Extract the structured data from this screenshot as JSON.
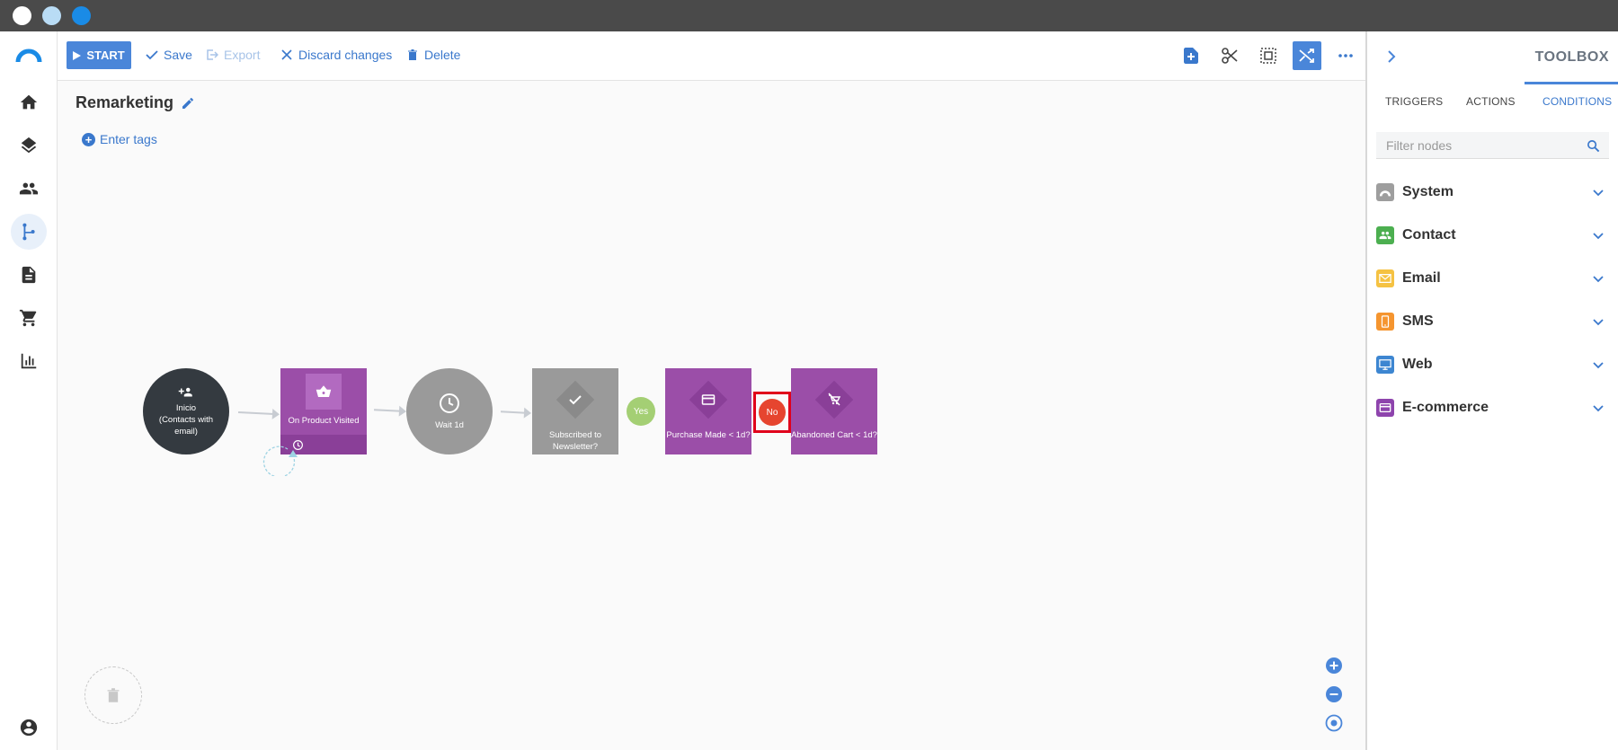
{
  "window": {
    "controls": [
      "close",
      "minimize",
      "maximize"
    ]
  },
  "nav": {
    "items": [
      {
        "name": "home",
        "icon": "home-icon"
      },
      {
        "name": "layers",
        "icon": "layers-icon"
      },
      {
        "name": "contacts",
        "icon": "people-icon"
      },
      {
        "name": "automation",
        "icon": "flow-icon",
        "active": true
      },
      {
        "name": "forms",
        "icon": "document-icon"
      },
      {
        "name": "ecommerce",
        "icon": "cart-icon"
      },
      {
        "name": "reports",
        "icon": "bar-chart-icon"
      },
      {
        "name": "account",
        "icon": "user-icon"
      }
    ]
  },
  "toolbar": {
    "start_label": "START",
    "save_label": "Save",
    "export_label": "Export",
    "discard_label": "Discard changes",
    "delete_label": "Delete",
    "icons": [
      "add-note-icon",
      "scissors-icon",
      "select-area-icon",
      "shuffle-icon",
      "more-icon"
    ]
  },
  "flow": {
    "title": "Remarketing",
    "tags_label": "Enter tags",
    "nodes": {
      "start": {
        "line1": "Inicio",
        "line2": "(Contacts with",
        "line3": "email)"
      },
      "product_visited": {
        "label": "On Product Visited"
      },
      "wait": {
        "label": "Wait 1d"
      },
      "subscribed": {
        "line1": "Subscribed to",
        "line2": "Newsletter?"
      },
      "purchase": {
        "label": "Purchase Made < 1d?"
      },
      "abandoned": {
        "label": "Abandoned Cart < 1d?"
      }
    },
    "yes_label": "Yes",
    "no_label": "No"
  },
  "toolbox": {
    "title": "TOOLBOX",
    "tabs": [
      {
        "label": "TRIGGERS"
      },
      {
        "label": "ACTIONS"
      },
      {
        "label": "CONDITIONS",
        "active": true
      }
    ],
    "filter_placeholder": "Filter nodes",
    "categories": [
      {
        "label": "System",
        "color": "#9e9e9e",
        "icon": "rainbow-icon"
      },
      {
        "label": "Contact",
        "color": "#4caf50",
        "icon": "people-icon"
      },
      {
        "label": "Email",
        "color": "#f5c242",
        "icon": "envelope-icon"
      },
      {
        "label": "SMS",
        "color": "#f5952f",
        "icon": "phone-icon"
      },
      {
        "label": "Web",
        "color": "#3d86d1",
        "icon": "monitor-icon"
      },
      {
        "label": "E-commerce",
        "color": "#8e44ad",
        "icon": "card-icon"
      }
    ]
  },
  "colors": {
    "accent": "#4a86d9",
    "node_purple": "#9b4ea8",
    "node_gray": "#9a9a9a",
    "node_dark": "#343a40",
    "yes": "#a4cf74",
    "no": "#e6452f"
  }
}
